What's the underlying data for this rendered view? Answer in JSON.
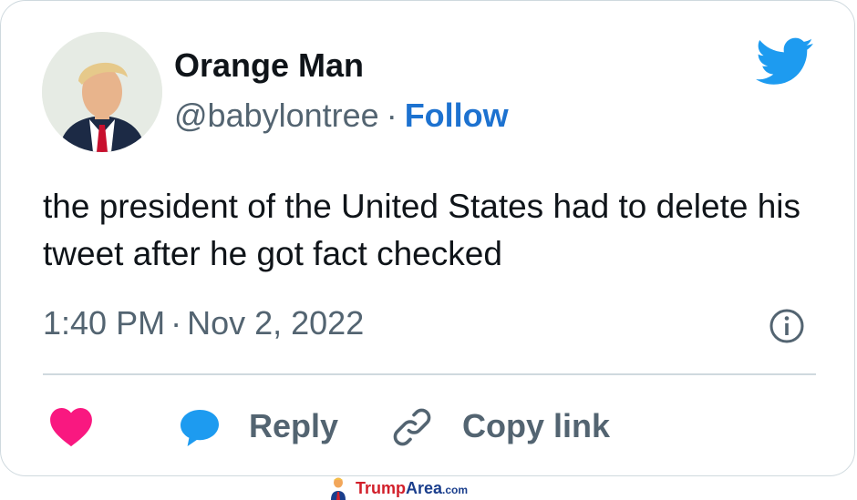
{
  "tweet": {
    "author_name": "Orange Man",
    "handle": "@babylontree",
    "separator": "·",
    "follow_label": "Follow",
    "text": "the president of the United States had to delete his tweet after he got fact checked",
    "time": "1:40 PM",
    "date": "Nov 2, 2022"
  },
  "actions": {
    "reply_label": "Reply",
    "copy_link_label": "Copy link"
  },
  "watermark": {
    "trump": "Trump",
    "area": "Area",
    "com": ".com"
  },
  "icons": [
    "twitter-bird-icon",
    "info-icon",
    "heart-icon",
    "reply-bubble-icon",
    "link-icon"
  ],
  "colors": {
    "follow": "#1d72d0",
    "twitter_blue": "#1d9bf0",
    "heart": "#f91880",
    "secondary_text": "#536471",
    "primary_text": "#0f1419"
  }
}
